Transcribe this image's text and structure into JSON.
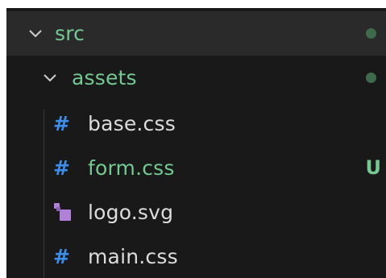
{
  "explorer": {
    "items": [
      {
        "label": "src",
        "type": "folder",
        "expanded": true,
        "status": "dot"
      },
      {
        "label": "assets",
        "type": "folder",
        "expanded": true,
        "status": "dot"
      },
      {
        "label": "base.css",
        "type": "css-file",
        "icon": "#"
      },
      {
        "label": "form.css",
        "type": "css-file",
        "icon": "#",
        "status": "U"
      },
      {
        "label": "logo.svg",
        "type": "svg-file",
        "icon": "svg-file-icon"
      },
      {
        "label": "main.css",
        "type": "css-file",
        "icon": "#"
      }
    ]
  },
  "colors": {
    "background": "#191919",
    "selected_row": "#2a2a2a",
    "git_untracked": "#73c991",
    "css_icon": "#3b8eea",
    "svg_icon": "#b180d7",
    "text": "#dcdcdc"
  }
}
